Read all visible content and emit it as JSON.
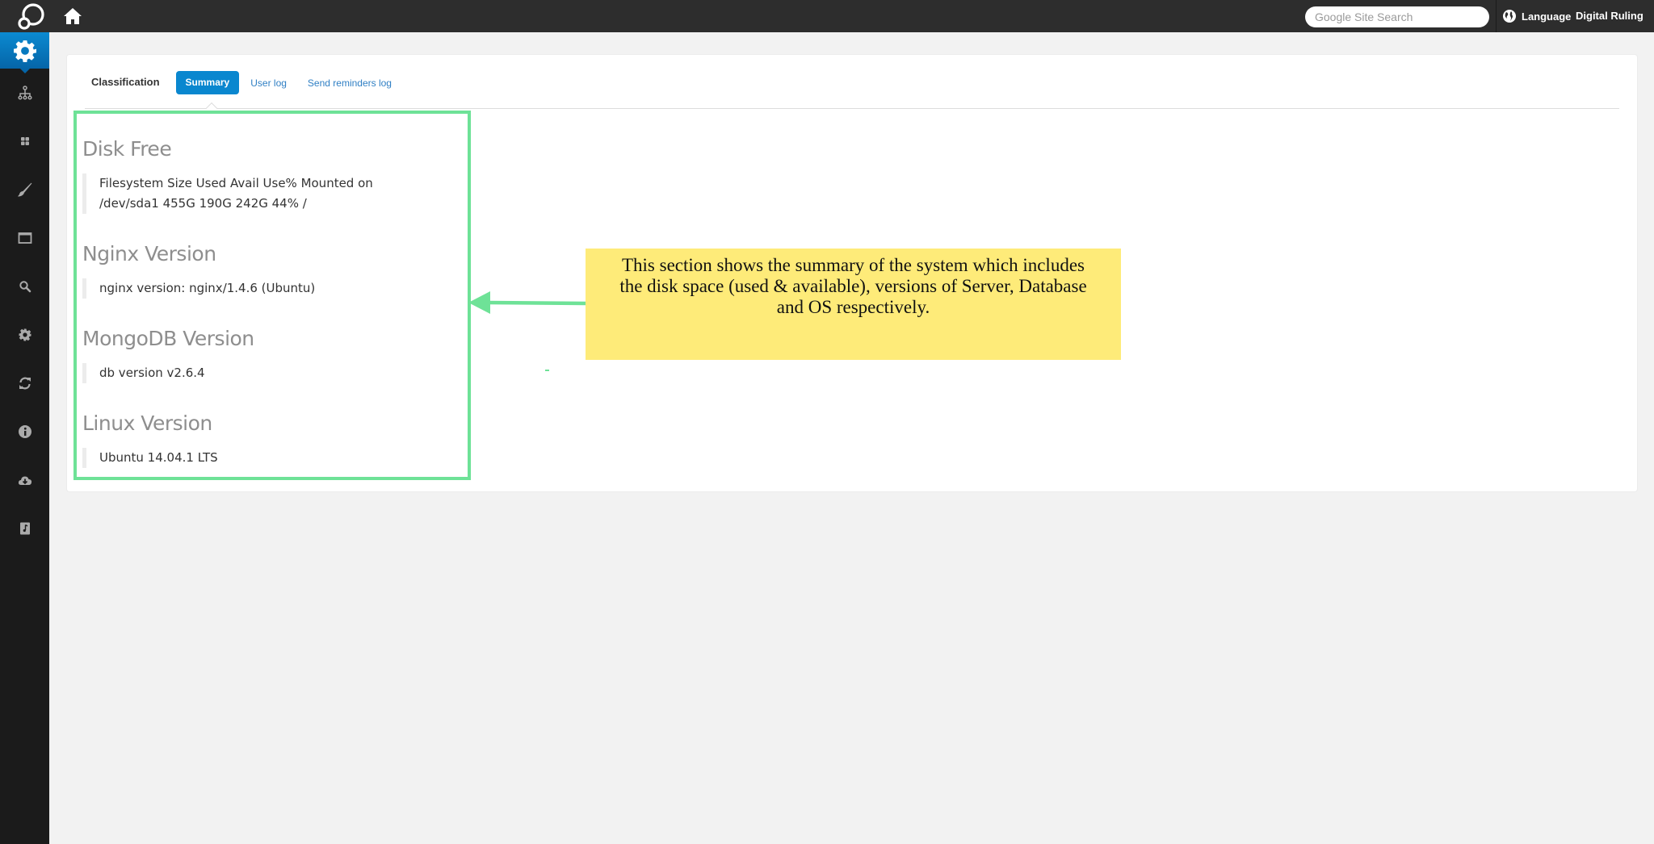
{
  "topbar": {
    "logo_icon": "app-logo-icon",
    "home_icon": "home-icon",
    "search": {
      "placeholder": "Google Site Search",
      "value": ""
    },
    "language_label": "Language",
    "brand_label": "Digital Ruling"
  },
  "sidebar": {
    "items": [
      {
        "icon": "gear-icon",
        "active": true
      },
      {
        "icon": "sitemap-icon"
      },
      {
        "icon": "grid-icon"
      },
      {
        "icon": "brush-icon"
      },
      {
        "icon": "window-icon"
      },
      {
        "icon": "search-icon"
      },
      {
        "icon": "cog-icon"
      },
      {
        "icon": "refresh-icon"
      },
      {
        "icon": "info-icon"
      },
      {
        "icon": "cloud-download-icon"
      },
      {
        "icon": "music-file-icon"
      }
    ]
  },
  "tabs": {
    "title": "Classification",
    "items": [
      {
        "label": "Summary",
        "active": true
      },
      {
        "label": "User log"
      },
      {
        "label": "Send reminders log"
      }
    ]
  },
  "sections": [
    {
      "heading": "Disk Free",
      "lines": [
        "Filesystem Size Used Avail Use% Mounted on",
        "/dev/sda1 455G 190G 242G 44% /"
      ]
    },
    {
      "heading": "Nginx Version",
      "lines": [
        "nginx version: nginx/1.4.6 (Ubuntu)"
      ]
    },
    {
      "heading": "MongoDB Version",
      "lines": [
        "db version v2.6.4"
      ]
    },
    {
      "heading": "Linux Version",
      "lines": [
        "Ubuntu 14.04.1 LTS"
      ]
    }
  ],
  "annotation": {
    "text": "This section shows the summary of the system which includes the disk space (used & available), versions of Server, Database and OS respectively.",
    "highlight_color": "#6ee297",
    "note_color": "#feeb79"
  },
  "colors": {
    "accent": "#0a87cf",
    "link": "#2f7fc4",
    "topbar": "#2d2d2d",
    "sidebar": "#1b1b1b"
  }
}
